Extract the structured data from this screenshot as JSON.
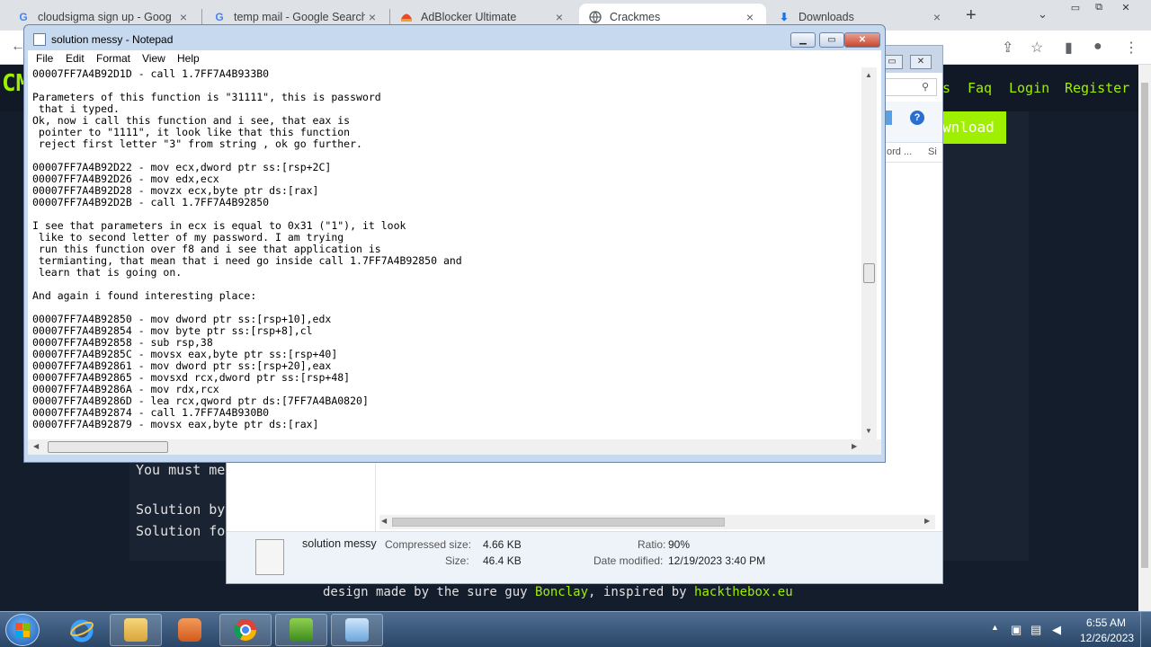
{
  "browser": {
    "tabs": [
      {
        "title": "cloudsigma sign up - Goog",
        "icon": "google-icon"
      },
      {
        "title": "temp mail - Google Search",
        "icon": "google-icon"
      },
      {
        "title": "AdBlocker Ultimate",
        "icon": "adblocker-icon"
      },
      {
        "title": "Crackmes",
        "icon": "globe-icon"
      },
      {
        "title": "Downloads",
        "icon": "download-icon"
      }
    ],
    "new_tab": "+",
    "tab_search": "⌄",
    "close": "×"
  },
  "site": {
    "logo": "CM",
    "nav": [
      "s",
      "Faq",
      "Login",
      "Register"
    ],
    "download": "wnload",
    "lines": [
      "You must me",
      "Solution by",
      "Solution fo"
    ],
    "footer": {
      "prefix": "design made by the sure guy",
      "author": "Bonclay",
      "middle": ", inspired by",
      "site": "hackthebox.eu"
    }
  },
  "archive": {
    "col_header": "ord ...",
    "col_header2": "Si",
    "file_name": "solution messy",
    "compressed_label": "Compressed size:",
    "compressed_value": "4.66 KB",
    "size_label": "Size:",
    "size_value": "46.4 KB",
    "ratio_label": "Ratio:",
    "ratio_value": "90%",
    "modified_label": "Date modified:",
    "modified_value": "12/19/2023 3:40 PM"
  },
  "notepad": {
    "title": "solution messy - Notepad",
    "menu": [
      "File",
      "Edit",
      "Format",
      "View",
      "Help"
    ],
    "text": "00007FF7A4B92D1D - call 1.7FF7A4B933B0\n\nParameters of this function is \"31111\", this is password\n that i typed.\nOk, now i call this function and i see, that eax is\n pointer to \"1111\", it look like that this function\n reject first letter \"3\" from string , ok go further.\n\n00007FF7A4B92D22 - mov ecx,dword ptr ss:[rsp+2C]\n00007FF7A4B92D26 - mov edx,ecx\n00007FF7A4B92D28 - movzx ecx,byte ptr ds:[rax]\n00007FF7A4B92D2B - call 1.7FF7A4B92850\n\nI see that parameters in ecx is equal to 0x31 (\"1\"), it look\n like to second letter of my password. I am trying\n run this function over f8 and i see that application is\n termianting, that mean that i need go inside call 1.7FF7A4B92850 and\n learn that is going on.\n\nAnd again i found interesting place:\n\n00007FF7A4B92850 - mov dword ptr ss:[rsp+10],edx\n00007FF7A4B92854 - mov byte ptr ss:[rsp+8],cl\n00007FF7A4B92858 - sub rsp,38\n00007FF7A4B9285C - movsx eax,byte ptr ss:[rsp+40]\n00007FF7A4B92861 - mov dword ptr ss:[rsp+20],eax\n00007FF7A4B92865 - movsxd rcx,dword ptr ss:[rsp+48]\n00007FF7A4B9286A - mov rdx,rcx\n00007FF7A4B9286D - lea rcx,qword ptr ds:[7FF7A4BA0820]\n00007FF7A4B92874 - call 1.7FF7A4B930B0\n00007FF7A4B92879 - movsx eax,byte ptr ds:[rax]"
  },
  "taskbar": {
    "time": "6:55 AM",
    "date": "12/26/2023"
  }
}
